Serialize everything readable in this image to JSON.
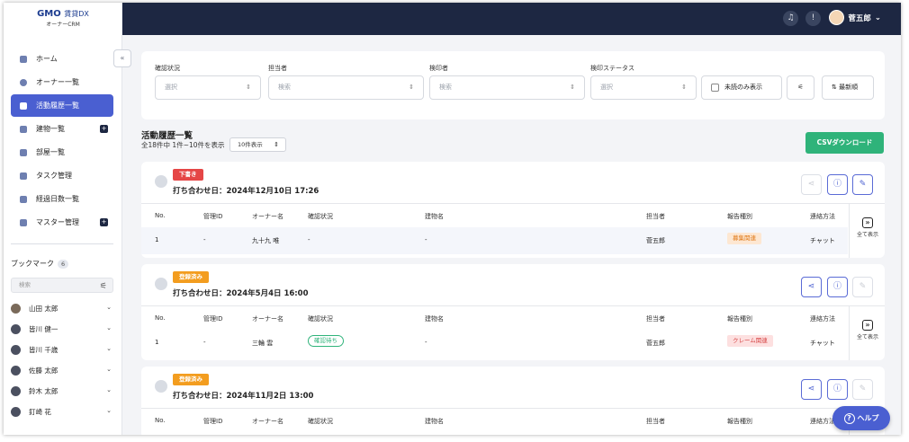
{
  "logo": {
    "brand": "GMO",
    "product": "賃貸DX",
    "sub": "オーナーCRM"
  },
  "topbar": {
    "user_name": "菅五郎"
  },
  "nav": [
    {
      "label": "ホーム",
      "icon": "home-icon",
      "active": false,
      "plus": false
    },
    {
      "label": "オーナー一覧",
      "icon": "owner-icon",
      "active": false,
      "plus": false
    },
    {
      "label": "活動履歴一覧",
      "icon": "history-icon",
      "active": true,
      "plus": false
    },
    {
      "label": "建物一覧",
      "icon": "building-icon",
      "active": false,
      "plus": true
    },
    {
      "label": "部屋一覧",
      "icon": "room-icon",
      "active": false,
      "plus": false
    },
    {
      "label": "タスク管理",
      "icon": "task-icon",
      "active": false,
      "plus": false
    },
    {
      "label": "経過日数一覧",
      "icon": "calendar-icon",
      "active": false,
      "plus": false
    },
    {
      "label": "マスター管理",
      "icon": "master-icon",
      "active": false,
      "plus": true
    }
  ],
  "bookmarks": {
    "title": "ブックマーク",
    "count": "6",
    "search_placeholder": "検索",
    "items": [
      "山田 太郎",
      "皆川 健一",
      "皆川 千歳",
      "佐藤 太郎",
      "鈴木 太郎",
      "釘崎 花"
    ]
  },
  "filters": {
    "confirm_label": "確認状況",
    "confirm_value": "選択",
    "person_label": "担当者",
    "person_value": "検索",
    "stamp_label": "検印者",
    "stamp_value": "検索",
    "status_label": "検印ステータス",
    "status_value": "選択",
    "unread_label": "未読のみ表示",
    "sort_label": "最新順"
  },
  "list": {
    "title": "活動履歴一覧",
    "summary": "全18件中 1件~10件を表示",
    "per_page": "10件表示",
    "csv_label": "CSVダウンロード"
  },
  "columns": [
    "No.",
    "管理ID",
    "オーナー名",
    "確認状況",
    "建物名",
    "担当者",
    "報告種別",
    "連絡方法"
  ],
  "expand_label": "全て表示",
  "cards": [
    {
      "badge": "下書き",
      "title": "打ち合わせ日：2024年12月10日 17:26",
      "row": {
        "no": "1",
        "id": "-",
        "owner": "九十九 唯",
        "confirm": "-",
        "building": "-",
        "person": "菅五郎",
        "type": "募集関連",
        "method": "チャット"
      }
    },
    {
      "badge": "登録済み",
      "title": "打ち合わせ日：2024年5月4日 16:00",
      "row": {
        "no": "1",
        "id": "-",
        "owner": "三輪 雲",
        "confirm": "確認待ち",
        "building": "-",
        "person": "菅五郎",
        "type": "クレーム関連",
        "method": "チャット"
      }
    },
    {
      "badge": "登録済み",
      "title": "打ち合わせ日：2024年11月2日 13:00"
    }
  ],
  "help_label": "ヘルプ"
}
